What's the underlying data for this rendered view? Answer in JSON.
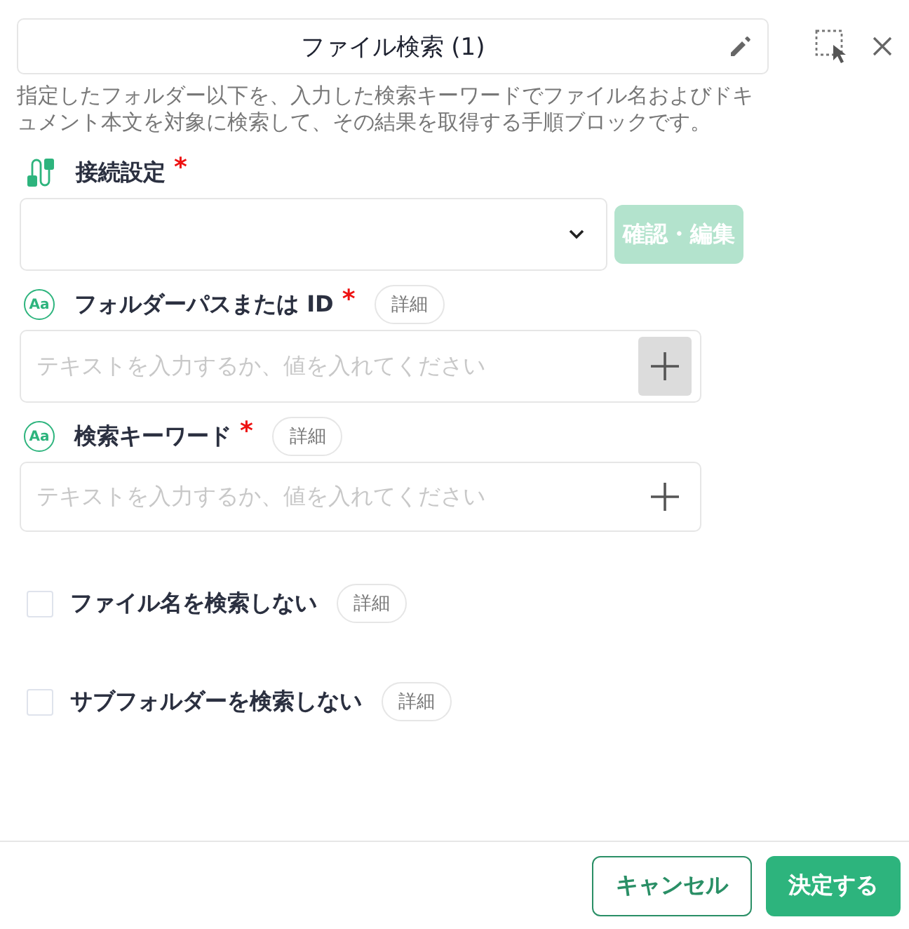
{
  "header": {
    "title": "ファイル検索 (1)",
    "description": "指定したフォルダー以下を、入力した検索キーワードでファイル名およびドキュメント本文を対象に検索して、その結果を取得する手順ブロックです。"
  },
  "fields": [
    {
      "kind": "select",
      "label": "接続設定",
      "required": "*",
      "action": {
        "label": "確認・編集",
        "disabled": true
      }
    },
    {
      "kind": "text",
      "icon_text": "Aa",
      "label": "フォルダーパスまたは ID",
      "required": "*",
      "detail": "詳細",
      "placeholder": "テキストを入力するか、値を入れてください",
      "plus_highlighted": true
    },
    {
      "kind": "text",
      "icon_text": "Aa",
      "label": "検索キーワード",
      "required": "*",
      "detail": "詳細",
      "placeholder": "テキストを入力するか、値を入れてください",
      "plus_highlighted": false
    },
    {
      "kind": "checkbox",
      "label": "ファイル名を検索しない",
      "detail": "詳細",
      "checked": false
    },
    {
      "kind": "checkbox",
      "label": "サブフォルダーを検索しない",
      "detail": "詳細",
      "checked": false
    }
  ],
  "footer": {
    "buttons": [
      {
        "label": "キャンセル",
        "kind": "secondary"
      },
      {
        "label": "決定する",
        "kind": "primary"
      }
    ]
  }
}
